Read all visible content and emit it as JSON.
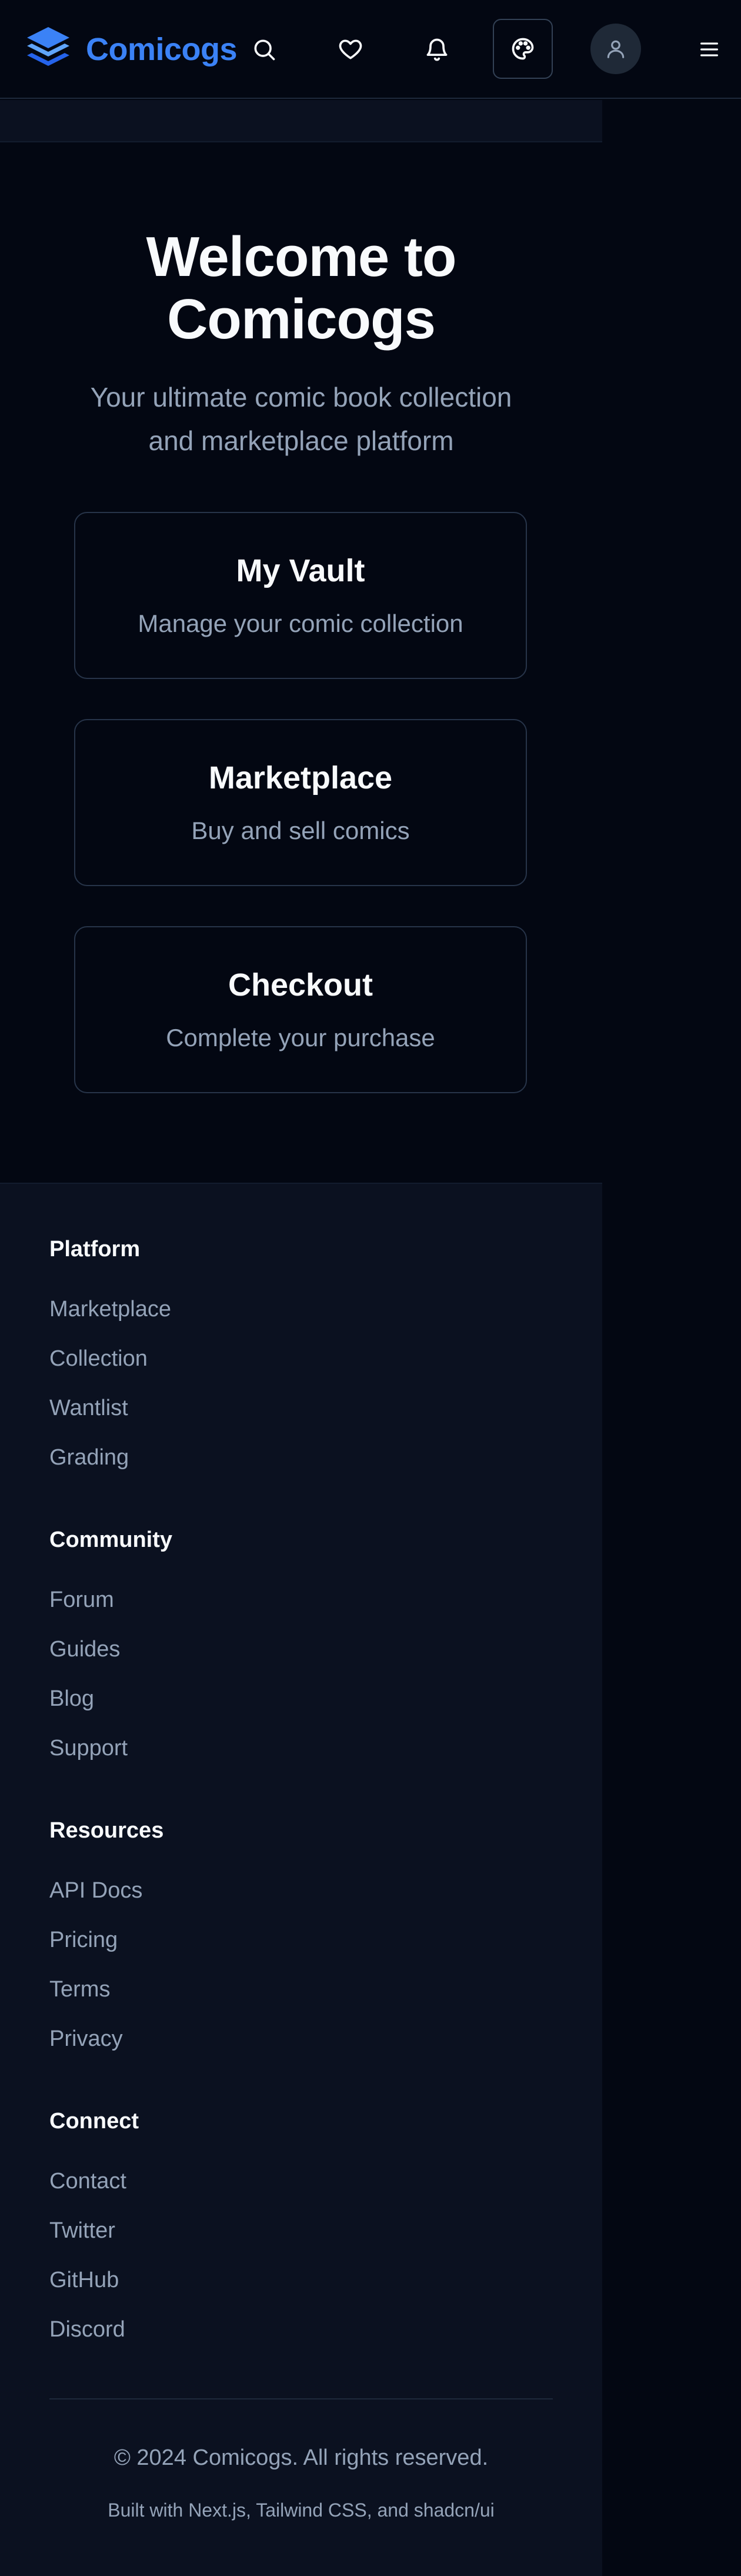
{
  "header": {
    "brand": "Comicogs",
    "icons": [
      "layers-logo-icon",
      "search-icon",
      "heart-icon",
      "bell-icon",
      "palette-icon",
      "user-icon",
      "menu-icon"
    ]
  },
  "hero": {
    "title": "Welcome to Comicogs",
    "subtitle": "Your ultimate comic book collection and marketplace platform"
  },
  "cards": [
    {
      "title": "My Vault",
      "description": "Manage your comic collection"
    },
    {
      "title": "Marketplace",
      "description": "Buy and sell comics"
    },
    {
      "title": "Checkout",
      "description": "Complete your purchase"
    }
  ],
  "footer": {
    "sections": [
      {
        "heading": "Platform",
        "links": [
          "Marketplace",
          "Collection",
          "Wantlist",
          "Grading"
        ]
      },
      {
        "heading": "Community",
        "links": [
          "Forum",
          "Guides",
          "Blog",
          "Support"
        ]
      },
      {
        "heading": "Resources",
        "links": [
          "API Docs",
          "Pricing",
          "Terms",
          "Privacy"
        ]
      },
      {
        "heading": "Connect",
        "links": [
          "Contact",
          "Twitter",
          "GitHub",
          "Discord"
        ]
      }
    ],
    "copyright": "© 2024 Comicogs. All rights reserved.",
    "built_with": "Built with Next.js, Tailwind CSS, and shadcn/ui"
  },
  "colors": {
    "brand": "#3b82f6",
    "background": "#030712",
    "surface": "#0b1120",
    "border": "#273449",
    "text": "#f8fafc",
    "muted": "#94a3b8"
  }
}
